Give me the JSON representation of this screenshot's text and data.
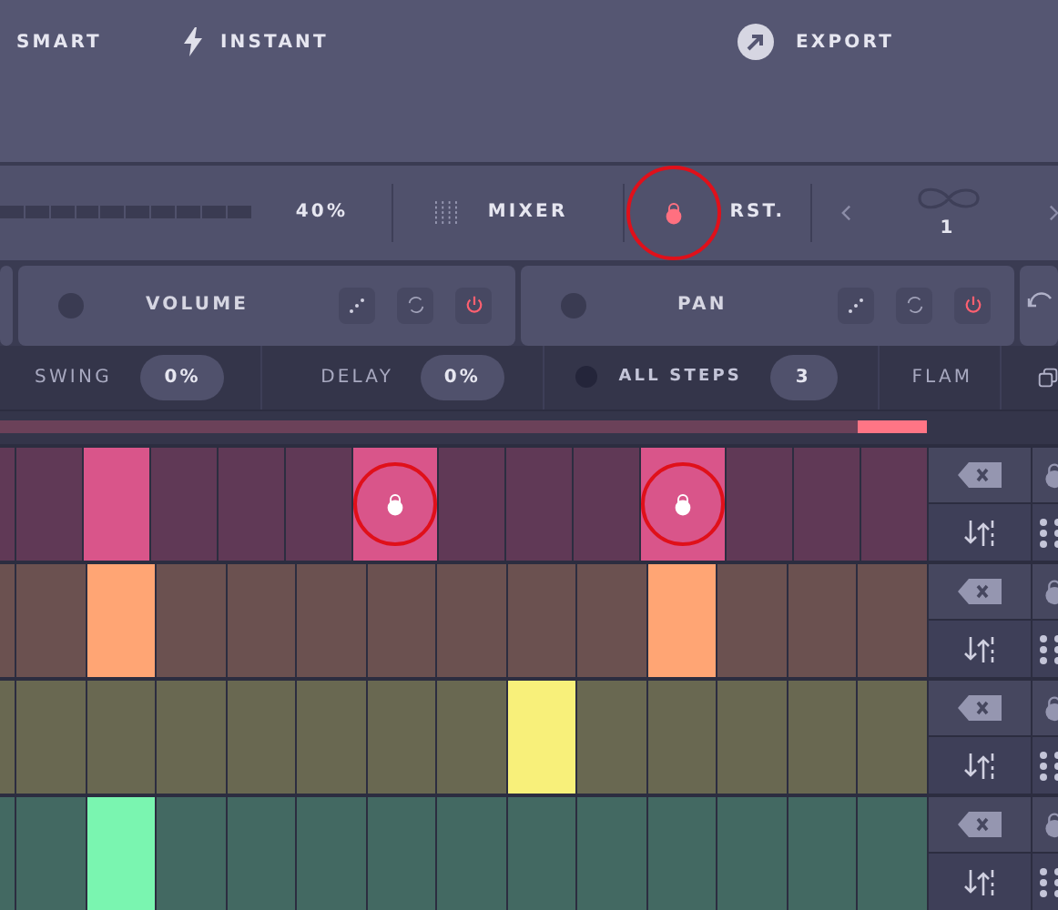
{
  "header": {
    "items": [
      {
        "kind": "text",
        "label": "SMART"
      },
      {
        "kind": "bolt",
        "label": "INSTANT"
      }
    ],
    "export": {
      "label": "EXPORT"
    }
  },
  "toolbar": {
    "meter": {
      "reading": "40%"
    },
    "mixer": {
      "label": "MIXER"
    },
    "reset": {
      "label": "RST.",
      "circled": true
    },
    "loop": {
      "count": "1"
    }
  },
  "panels": [
    {
      "label": "VOLUME",
      "power": true
    },
    {
      "label": "PAN",
      "power": true
    }
  ],
  "settings": {
    "swing": {
      "label": "SWING",
      "value": "0%"
    },
    "delay": {
      "label": "DELAY",
      "value": "0%"
    },
    "all_steps": {
      "label": "ALL STEPS",
      "value": "3",
      "on": false
    },
    "flam": {
      "label": "FLAM"
    }
  },
  "playhead": {
    "level": 0.925
  },
  "tracks": [
    {
      "color": "#d9558a",
      "steps": [
        {
          "on": false
        },
        {
          "on": false
        },
        {
          "on": true
        },
        {
          "on": false
        },
        {
          "on": false
        },
        {
          "on": false
        },
        {
          "on": true,
          "locked": true,
          "circled": true
        },
        {
          "on": false
        },
        {
          "on": false
        },
        {
          "on": false
        },
        {
          "on": true,
          "locked": true,
          "circled": true
        },
        {
          "on": false
        },
        {
          "on": false
        },
        {
          "on": false
        }
      ]
    },
    {
      "color": "#ffa574",
      "steps": [
        {
          "on": false
        },
        {
          "on": false
        },
        {
          "on": true
        },
        {
          "on": false
        },
        {
          "on": false
        },
        {
          "on": false
        },
        {
          "on": false
        },
        {
          "on": false
        },
        {
          "on": false
        },
        {
          "on": false
        },
        {
          "on": true
        },
        {
          "on": false
        },
        {
          "on": false
        },
        {
          "on": false
        }
      ]
    },
    {
      "color": "#f8f07a",
      "steps": [
        {
          "on": false
        },
        {
          "on": false
        },
        {
          "on": false
        },
        {
          "on": false
        },
        {
          "on": false
        },
        {
          "on": false
        },
        {
          "on": false
        },
        {
          "on": false
        },
        {
          "on": true
        },
        {
          "on": false
        },
        {
          "on": false
        },
        {
          "on": false
        },
        {
          "on": false
        },
        {
          "on": false
        }
      ]
    },
    {
      "color": "#7af5b0",
      "steps": [
        {
          "on": false
        },
        {
          "on": false
        },
        {
          "on": true
        },
        {
          "on": false
        },
        {
          "on": false
        },
        {
          "on": false
        },
        {
          "on": false
        },
        {
          "on": false
        },
        {
          "on": false
        },
        {
          "on": false
        },
        {
          "on": false
        },
        {
          "on": false
        },
        {
          "on": false
        },
        {
          "on": false
        }
      ]
    }
  ]
}
